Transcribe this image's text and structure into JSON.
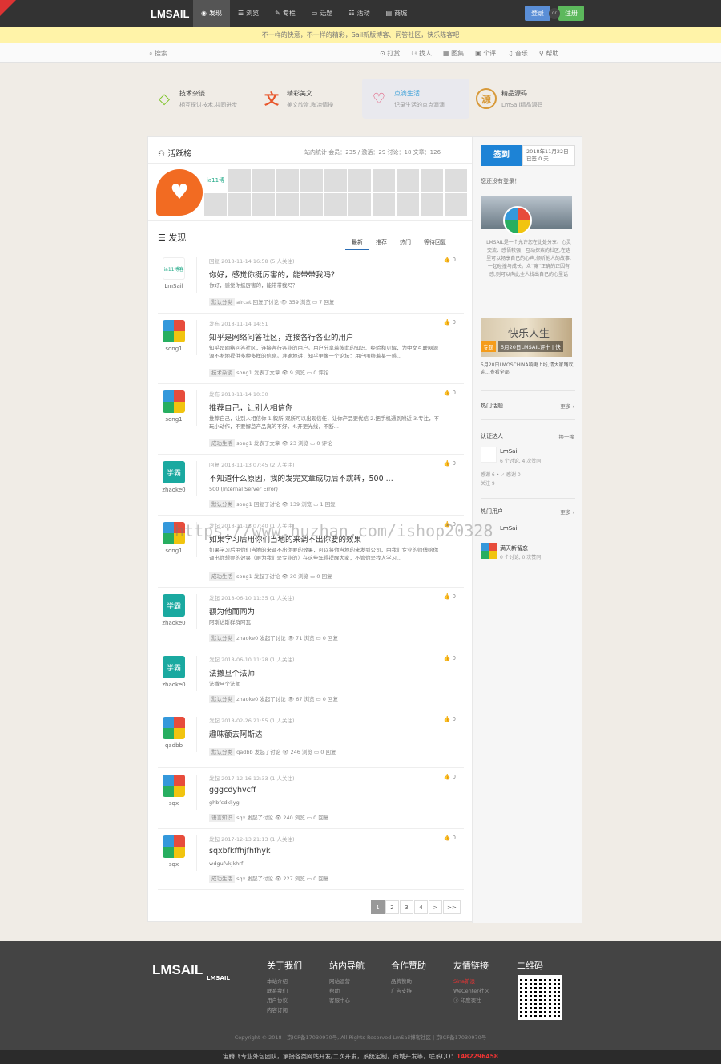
{
  "header": {
    "logo": "LMSAIL",
    "nav": [
      {
        "label": "发现",
        "icon": "◉"
      },
      {
        "label": "浏览",
        "icon": "☰"
      },
      {
        "label": "专栏",
        "icon": "✎"
      },
      {
        "label": "话题",
        "icon": "▭"
      },
      {
        "label": "活动",
        "icon": "☷"
      },
      {
        "label": "商城",
        "icon": "▤"
      }
    ],
    "login": "登录",
    "or": "or",
    "register": "注册"
  },
  "notice": "不一样的快意，不一样的精彩，Sail新版博客、问答社区，快乐陈客吧",
  "subbar": {
    "search": "搜索",
    "links": [
      "打赏",
      "找人",
      "图集",
      "个评",
      "音乐",
      "帮助"
    ]
  },
  "features": [
    {
      "title": "技术杂谈",
      "desc": "相互探讨技术,共同进步",
      "icon": "◇",
      "color": "#7cc425"
    },
    {
      "title": "精彩美文",
      "desc": "美文欣赏,陶冶情操",
      "icon": "文",
      "color": "#e8562b"
    },
    {
      "title": "点滴生活",
      "desc": "记录生活的点点滴滴",
      "icon": "♡",
      "color": "#e0456b"
    },
    {
      "title": "精品源码",
      "desc": "LmSail精品源码",
      "icon": "源",
      "color": "#d89a3a"
    }
  ],
  "active": {
    "title": "活跃榜",
    "stats": "站内统计  会员：235 / 激活：29  讨论：18  文章：126",
    "first": "ia11博客"
  },
  "find": {
    "title": "发现",
    "tabs": [
      "最新",
      "推荐",
      "热门",
      "等待回复"
    ]
  },
  "posts": [
    {
      "user": "LmSail",
      "avatar": "w",
      "av_text": "ia11博客",
      "meta": "回复 2018-11-14 16:58 (5 人关注)",
      "title": "你好，感觉你挺厉害的，能带带我吗？",
      "excerpt": "你好，感觉你挺厉害的，能带带我吗？",
      "cat": "默认分类",
      "foot": "aircat 回复了讨论  👁 359 浏览  ▭ 7 回复",
      "likes": "0",
      "h": 78
    },
    {
      "user": "song1",
      "avatar": "g",
      "meta": "发布 2018-11-14 14:51",
      "title": "知乎是网络问答社区，连接各行各业的用户",
      "excerpt": "知乎是网络问答社区，连接各行各业的用户。用户分享着彼此的知识、经验和见解，为中文互联网源源不断地提供多种多样的信息。准确地讲，知乎更像一个论坛：用户围绕着某一感...",
      "cat": "技术杂谈",
      "foot": "song1 发表了文章  👁 9 浏览  ▭ 0 评论",
      "likes": "0",
      "h": 88
    },
    {
      "user": "song1",
      "avatar": "g",
      "meta": "发布 2018-11-14 10:30",
      "title": "推荐自己，让别人相信你",
      "excerpt": "推荐自己，让别人相信你 1.毅所-观所可以出现信任，让你产品更优信 2.把手机通到附近 3.专注，不玩小动作，不要懈怠产品真的不好，4.开更光线，不断...",
      "cat": "成功生活",
      "foot": "song1 发表了文章  👁 23 浏览  ▭ 0 评论",
      "likes": "0",
      "h": 88
    },
    {
      "user": "zhaoke0",
      "avatar": "t",
      "av_text": "学霸",
      "meta": "回复 2018-11-13 07:45 (2 人关注)",
      "title": "不知道什么原因，我的发完文章成功后不跳转，500 ...",
      "excerpt": "500 (Internal Server Error)",
      "cat": "默认分类",
      "foot": "song1 回复了讨论  👁 139 浏览  ▭ 1 回复",
      "likes": "0",
      "h": 76
    },
    {
      "user": "song1",
      "avatar": "g",
      "meta": "发起 2018-11-13 07:40 (1 人关注)",
      "title": "如果学习后用你们当地的来调不出你要的效果",
      "excerpt": "如果学习后用你们当地的来调不出你要的效果，可以将你当地的来发到公司，由我们专业的师傅给你调出你想要的效果（限为我们是专业的）在这些年得提醒大家，不管你是找人学习...",
      "cat": "成功生活",
      "foot": "song1 发起了讨论  👁 30 浏览  ▭ 0 回复",
      "likes": "0",
      "h": 90
    },
    {
      "user": "zhaoke0",
      "avatar": "t",
      "av_text": "学霸",
      "meta": "发起 2018-06-10 11:35 (1 人关注)",
      "title": "额为他而同为",
      "excerpt": "阿斯达斯群群阿瓦",
      "cat": "默认分类",
      "foot": "zhaoke0 发起了讨论  👁 71 浏览  ▭ 0 回复",
      "likes": "0",
      "h": 77
    },
    {
      "user": "zhaoke0",
      "avatar": "t",
      "av_text": "学霸",
      "meta": "发起 2018-06-10 11:28 (1 人关注)",
      "title": "法撒旦个法师",
      "excerpt": "法撒旦个法师",
      "cat": "默认分类",
      "foot": "zhaoke0 发起了讨论  👁 67 浏览  ▭ 0 回复",
      "likes": "0",
      "h": 76
    },
    {
      "user": "qadbb",
      "avatar": "g",
      "meta": "发起 2018-02-26 21:55 (1 人关注)",
      "title": "趣味额去阿斯达",
      "excerpt": "",
      "cat": "默认分类",
      "foot": "qadbb 发起了讨论  👁 246 浏览  ▭ 0 回复",
      "likes": "0",
      "h": 72
    },
    {
      "user": "sqx",
      "avatar": "g",
      "meta": "发起 2017-12-16 12:33 (1 人关注)",
      "title": "gggcdyhvcff",
      "excerpt": "ghbfcdkljyg",
      "cat": "语言知识",
      "foot": "sqx 发起了讨论  👁 240 浏览  ▭ 0 回复",
      "likes": "0",
      "h": 76
    },
    {
      "user": "sqx",
      "avatar": "g",
      "meta": "发起 2017-12-13 21:13 (1 人关注)",
      "title": "sqxbfkffhjfhfhyk",
      "excerpt": "wdgufvkjkhrf",
      "cat": "成功生活",
      "foot": "sqx 发起了讨论  👁 227 浏览  ▭ 0 回复",
      "likes": "0",
      "h": 76
    }
  ],
  "pager": [
    "1",
    "2",
    "3",
    "4",
    ">",
    ">>"
  ],
  "right": {
    "signin": "签到",
    "date": "2018年11月22日",
    "signed": "已签 0 天",
    "not_login": "您还没有登录！",
    "para": "LMSAIL是一个允许您在此处分享、心灵交流、感悟较强，互动探索的社区,在这里可以畅享自己的心声,倾听他人的故事,一起碰撞与成长。众“嘛”正确的正因有感,则可以向此全人找出自己的心里话",
    "banner_cap": "快乐人生",
    "banner_tag": "专题",
    "banner_title": "5月20日LMSAIL评十 | 快",
    "banner_desc": "5月20日LMOSCHINA响更上线,请大家踊欢迎...查看全部",
    "hot_topics": "热门话题",
    "more": "更多 ›",
    "verified": "认证达人",
    "switch": "换一换",
    "v_name": "LmSail",
    "v_stat": "6 个讨论, 4 次赞同",
    "v_stat2": "感谢 6 • ✓ 感谢 0",
    "v_follow": "关注 9",
    "hot_users": "热门用户",
    "hu_name": "LmSail",
    "hu2_name": "满天新留恋",
    "hu2_stat": "0 个讨论, 0 次赞同"
  },
  "footer": {
    "logo": "LMSAIL",
    "logo_sub": "LMSAIL",
    "cols": [
      {
        "title": "关于我们",
        "items": [
          "本站介绍",
          "联系我们",
          "用户协议",
          "内容订阅"
        ]
      },
      {
        "title": "站内导航",
        "items": [
          "网站运营",
          "帮助",
          "客服中心"
        ]
      },
      {
        "title": "合作赞助",
        "items": [
          "品牌赞助",
          "广告支持"
        ]
      },
      {
        "title": "友情链接",
        "items": [
          "Sina新浪",
          "WeCenter社区",
          "ⓘ 印度夜社"
        ]
      },
      {
        "title": "二维码",
        "items": []
      }
    ],
    "copyright": "Copyright © 2018 - 京ICP备17030970号, All Rights Reserved LmSail博客社区 | 京ICP备17030970号",
    "bottom": "宙腾飞专业外包团队，承接各类网站开发/二次开发，系统定制，商城开发等，联系QQ：",
    "qq": "1482296458"
  },
  "watermark": "https://www.huzhan.com/ishop20328"
}
